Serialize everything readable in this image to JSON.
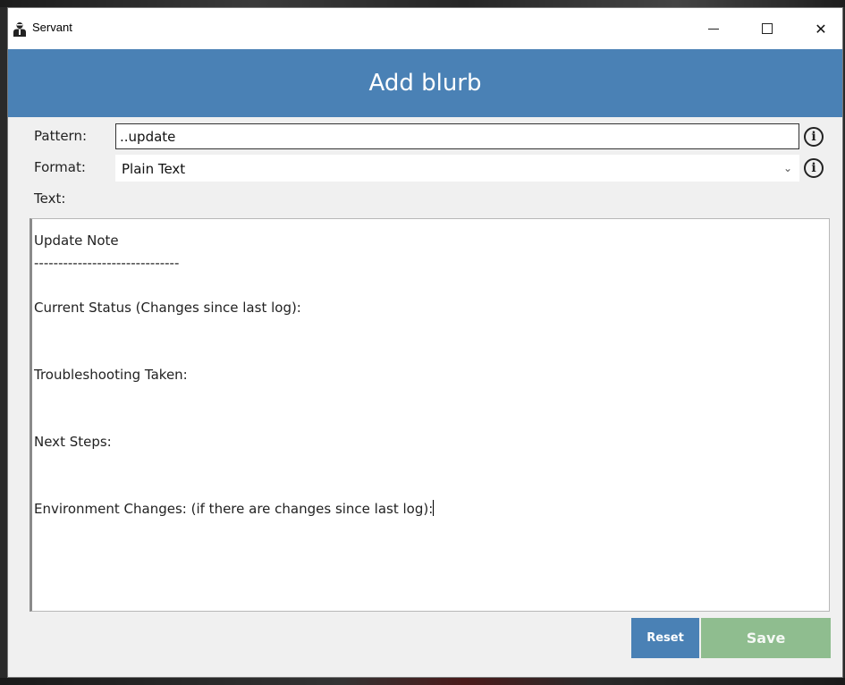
{
  "window": {
    "title": "Servant",
    "app_icon": "servant-person-icon",
    "controls": {
      "minimize": "minimize-icon",
      "maximize": "maximize-icon",
      "close_glyph": "✕"
    }
  },
  "header": {
    "title": "Add blurb",
    "color": "#4a81b5"
  },
  "form": {
    "pattern_label": "Pattern:",
    "pattern_value": "..update",
    "format_label": "Format:",
    "format_value": "Plain Text",
    "format_chevron": "⌄",
    "text_label": "Text:",
    "info_glyph": "i",
    "text_lines": [
      "Update Note",
      "------------------------------",
      "",
      "Current Status (Changes since last log):",
      "",
      "",
      "Troubleshooting Taken:",
      "",
      "",
      "Next Steps:",
      "",
      "",
      "Environment Changes: (if there are changes since last log):"
    ]
  },
  "buttons": {
    "reset_label": "Reset",
    "save_label": "Save",
    "reset_color": "#4a81b5",
    "save_color": "#8fbd8f"
  }
}
